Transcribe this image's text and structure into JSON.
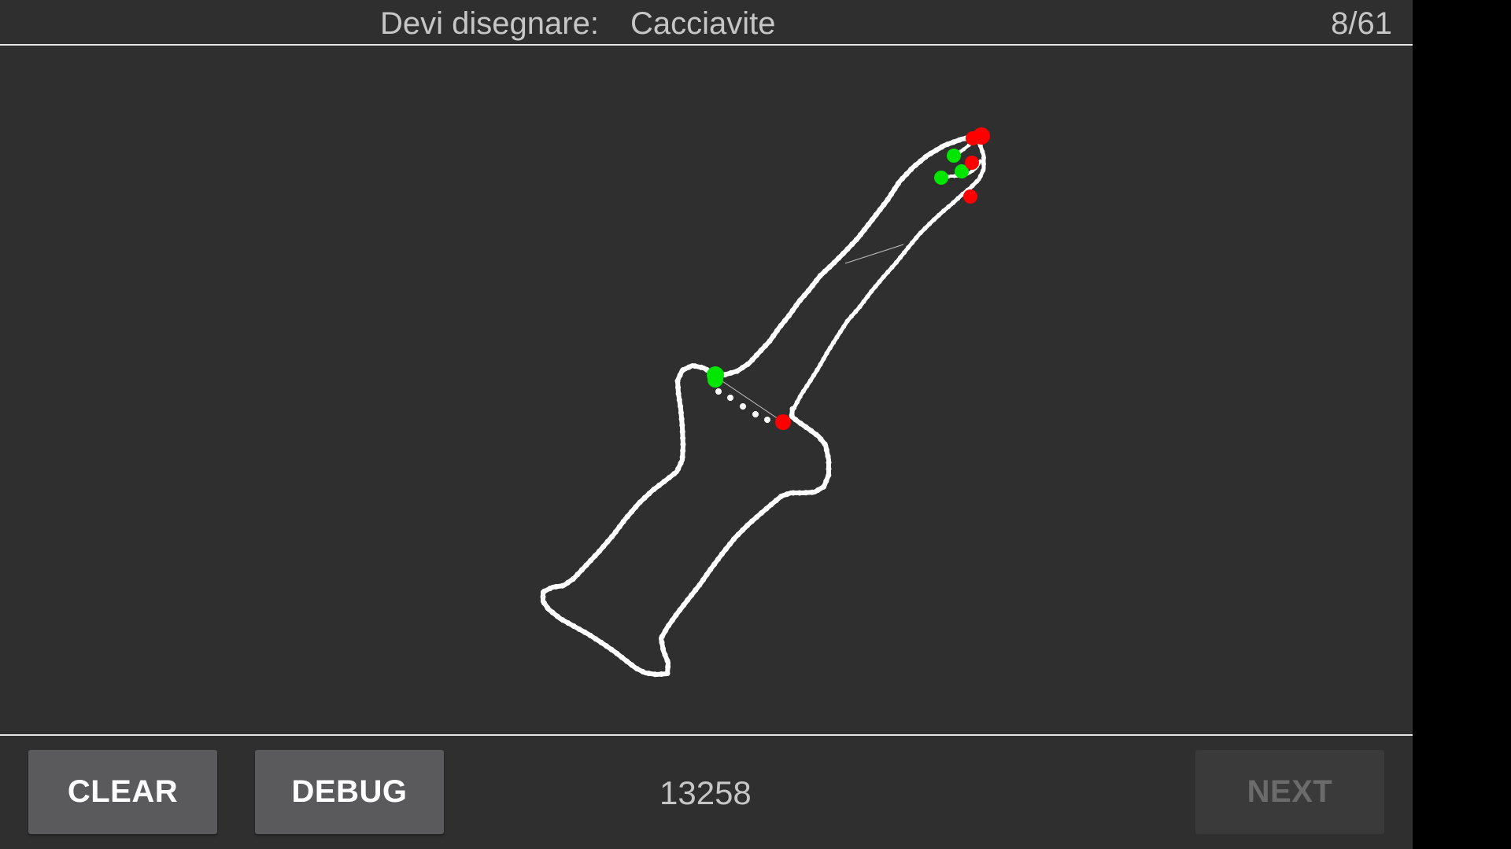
{
  "header": {
    "prompt_label": "Devi disegnare:",
    "prompt_word": "Cacciavite",
    "progress": "8/61"
  },
  "toolbar": {
    "clear_label": "CLEAR",
    "debug_label": "DEBUG",
    "score": "13258",
    "next_label": "NEXT",
    "next_enabled": false
  },
  "drawing": {
    "stroke_color": "#ffffff",
    "start_marker_color": "#00e600",
    "end_marker_color": "#ff0000",
    "background_color": "#2f2f2f"
  }
}
